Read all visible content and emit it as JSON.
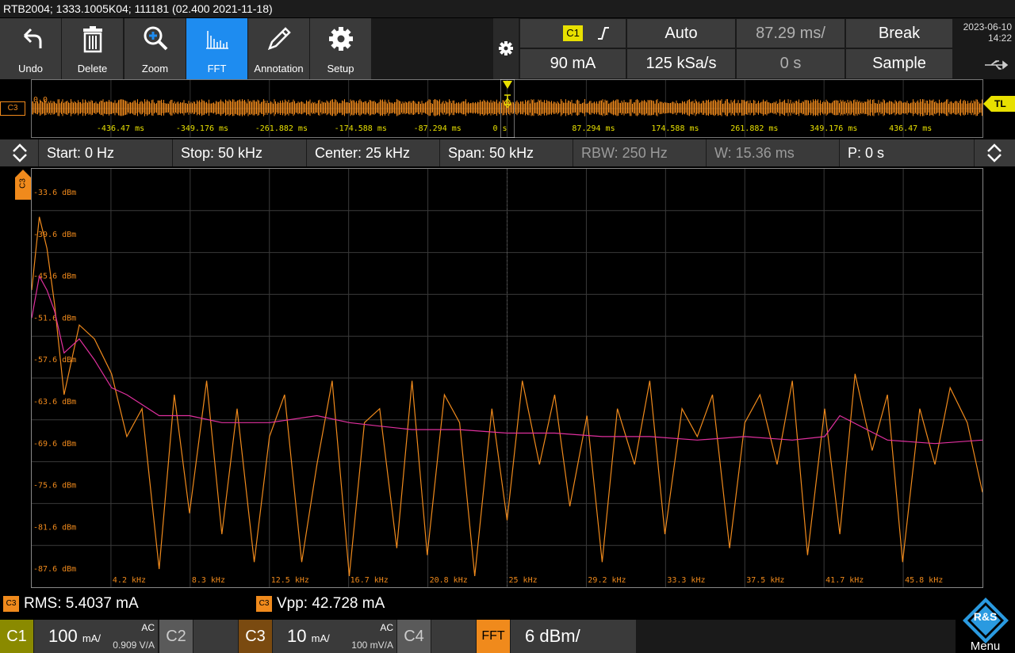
{
  "title": "RTB2004; 1333.1005K04; 111181 (02.400 2021-11-18)",
  "toolbar": {
    "undo": "Undo",
    "delete": "Delete",
    "zoom": "Zoom",
    "fft": "FFT",
    "annotation": "Annotation",
    "setup": "Setup"
  },
  "trigger": {
    "source": "C1",
    "slope": "rising-edge-icon",
    "mode": "Auto",
    "time_div": "87.29 ms/",
    "break": "Break",
    "level": "90 mA",
    "sample_rate": "125 kSa/s",
    "position": "0 s",
    "acq": "Sample"
  },
  "clock": {
    "date": "2023-06-10",
    "time": "14:22"
  },
  "overview": {
    "channel": "C3",
    "offset_label": "0.0",
    "trigger_level_tag": "TL",
    "time_labels": [
      "-436.47 ms",
      "-349.176 ms",
      "-261.882 ms",
      "-174.588 ms",
      "-87.294 ms",
      "0 s",
      "87.294 ms",
      "174.588 ms",
      "261.882 ms",
      "349.176 ms",
      "436.47 ms"
    ]
  },
  "fft": {
    "start": "Start: 0 Hz",
    "stop": "Stop: 50 kHz",
    "center": "Center: 25 kHz",
    "span": "Span: 50 kHz",
    "rbw": "RBW: 250 Hz",
    "window": "W: 15.36 ms",
    "pos": "P: 0 s"
  },
  "chart_data": {
    "type": "line",
    "channel_tag": "C3",
    "ytick_labels": [
      "-33.6 dBm",
      "-39.6 dBm",
      "-45.6 dBm",
      "-51.6 dBm",
      "-57.6 dBm",
      "-63.6 dBm",
      "-69.6 dBm",
      "-75.6 dBm",
      "-81.6 dBm",
      "-87.6 dBm"
    ],
    "xtick_labels": [
      "4.2 kHz",
      "8.3 kHz",
      "12.5 kHz",
      "16.7 kHz",
      "20.8 kHz",
      "25 kHz",
      "29.2 kHz",
      "33.3 kHz",
      "37.5 kHz",
      "41.7 kHz",
      "45.8 kHz"
    ],
    "xlim": [
      0,
      50000
    ],
    "ylim": [
      -87.6,
      -27.6
    ],
    "grid": true,
    "series": [
      {
        "color": "#f08a1c",
        "x": [
          0,
          400,
          800,
          1200,
          1700,
          2500,
          3300,
          4200,
          5000,
          5800,
          6700,
          7500,
          8300,
          9200,
          10000,
          10800,
          11700,
          12500,
          13300,
          14200,
          15000,
          15800,
          16700,
          17500,
          18300,
          19200,
          20000,
          20800,
          21700,
          22500,
          23300,
          24200,
          25000,
          25800,
          26700,
          27500,
          28300,
          29200,
          30000,
          30800,
          31700,
          32500,
          33300,
          34200,
          35000,
          35800,
          36700,
          37500,
          38300,
          39200,
          40000,
          40800,
          41700,
          42500,
          43300,
          44200,
          45000,
          45800,
          46700,
          47500,
          48300,
          49200,
          50000
        ],
        "y": [
          -45,
          -34.5,
          -39,
          -47,
          -60,
          -50,
          -52,
          -57,
          -66,
          -62,
          -85,
          -60,
          -77,
          -58,
          -80,
          -62,
          -84,
          -66,
          -60,
          -84,
          -70,
          -58,
          -86,
          -64,
          -62,
          -82,
          -58,
          -83,
          -60,
          -64,
          -86,
          -62,
          -78,
          -58,
          -70,
          -60,
          -76,
          -63,
          -84,
          -62,
          -70,
          -58,
          -80,
          -62,
          -66,
          -60,
          -82,
          -64,
          -60,
          -70,
          -58,
          -83,
          -62,
          -80,
          -57,
          -68,
          -60,
          -84,
          -62,
          -70,
          -59,
          -64,
          -74
        ]
      },
      {
        "color": "#e0309e",
        "x": [
          0,
          400,
          800,
          1200,
          1700,
          2500,
          3300,
          4200,
          5000,
          6700,
          8300,
          10000,
          12500,
          15000,
          16700,
          18300,
          20000,
          22500,
          25000,
          27500,
          30000,
          32500,
          35000,
          37500,
          40000,
          41700,
          42500,
          45000,
          47500,
          50000
        ],
        "y": [
          -49,
          -43,
          -45,
          -48,
          -54,
          -52,
          -55,
          -59,
          -60,
          -63,
          -63,
          -64,
          -64,
          -63,
          -64,
          -64.5,
          -65,
          -65,
          -65.5,
          -65.5,
          -66,
          -66,
          -66.5,
          -66,
          -66.5,
          -66,
          -63,
          -66.5,
          -67,
          -66.5
        ]
      }
    ]
  },
  "measurements": {
    "rms": "RMS: 5.4037 mA",
    "vpp": "Vpp: 42.728 mA",
    "tag": "C3"
  },
  "channels": {
    "c1": {
      "label": "C1",
      "scale_num": "100",
      "scale_unit": "mA/",
      "coupling": "AC",
      "probe": "0.909 V/A"
    },
    "c2": {
      "label": "C2"
    },
    "c3": {
      "label": "C3",
      "scale_num": "10",
      "scale_unit": "mA/",
      "coupling": "AC",
      "probe": "100 mV/A"
    },
    "c4": {
      "label": "C4"
    },
    "fft": {
      "label": "FFT",
      "scale": "6 dBm/"
    }
  },
  "menu": {
    "label": "Menu",
    "logo": "R&S"
  }
}
